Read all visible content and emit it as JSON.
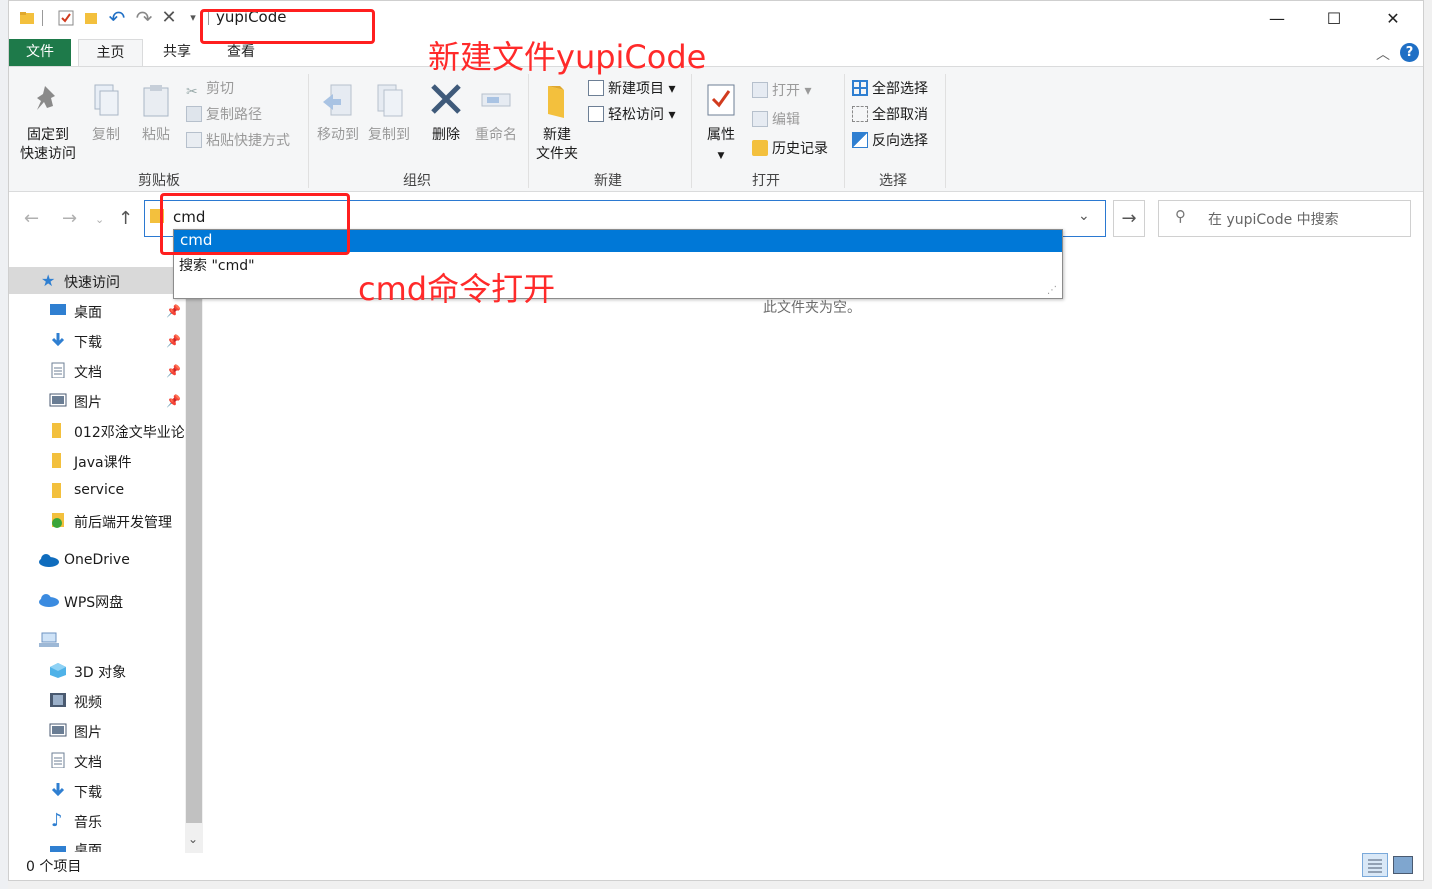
{
  "window": {
    "title": "yupiCode",
    "controls": {
      "minimize": "—",
      "maximize": "☐",
      "close": "✕"
    }
  },
  "ribbon": {
    "tabs": [
      "文件",
      "主页",
      "共享",
      "查看"
    ],
    "active_tab": "主页",
    "groups": {
      "clipboard": {
        "label": "剪贴板",
        "pin": "固定到\n快速访问",
        "pin_l1": "固定到",
        "pin_l2": "快速访问",
        "copy": "复制",
        "paste": "粘贴",
        "cut": "剪切",
        "copy_path": "复制路径",
        "paste_shortcut": "粘贴快捷方式"
      },
      "organize": {
        "label": "组织",
        "move_to": "移动到",
        "copy_to": "复制到",
        "delete": "删除",
        "rename": "重命名"
      },
      "new": {
        "label": "新建",
        "new_folder_l1": "新建",
        "new_folder_l2": "文件夹",
        "new_item": "新建项目",
        "easy_access": "轻松访问"
      },
      "open": {
        "label": "打开",
        "properties": "属性",
        "open": "打开",
        "edit": "编辑",
        "history": "历史记录"
      },
      "select": {
        "label": "选择",
        "select_all": "全部选择",
        "select_none": "全部取消",
        "invert": "反向选择"
      }
    }
  },
  "address": {
    "value": "cmd",
    "suggestions": [
      "cmd",
      "搜索 \"cmd\""
    ]
  },
  "search": {
    "placeholder": "在 yupiCode 中搜索"
  },
  "sidebar": {
    "quick_access": "快速访问",
    "quick_items": [
      "桌面",
      "下载",
      "文档",
      "图片",
      "012邓淦文毕业论",
      "Java课件",
      "service",
      "前后端开发管理"
    ],
    "onedrive": "OneDrive",
    "wps": "WPS网盘",
    "pc_items": [
      "3D 对象",
      "视频",
      "图片",
      "文档",
      "下载",
      "音乐",
      "桌面"
    ]
  },
  "main": {
    "empty_text": "此文件夹为空。"
  },
  "status": {
    "items": "0 个项目"
  },
  "annotations": {
    "new_file": "新建文件yupiCode",
    "cmd_open": "cmd命令打开"
  },
  "colors": {
    "accent": "#0078d7",
    "file_tab": "#1e7a4a",
    "annotation": "#ff1f1f"
  }
}
